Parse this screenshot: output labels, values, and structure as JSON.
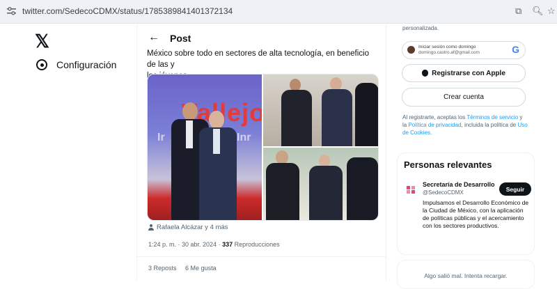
{
  "browser": {
    "url": "twitter.com/SedecoCDMX/status/1785389841401372134",
    "icons": [
      "site-settings-icon",
      "cast-icon",
      "zoom-icon",
      "bookmark-star-icon"
    ]
  },
  "nav": {
    "logo": "𝕏",
    "settings_label": "Configuración"
  },
  "post": {
    "back_arrow": "←",
    "header_title": "Post",
    "text_line1": "México sobre todo en sectores de alta tecnología, en beneficio de las y",
    "text_line2": "los jóvenes",
    "photo_text": "Vallejo",
    "photo_subtext_1": "Ir",
    "photo_subtext_2": "Inr",
    "tagged": "Rafaela Alcázar y 4 más",
    "time": "1:24 p. m. · 30 abr. 2024 · ",
    "views_count": "337",
    "views_label": " Reproducciones",
    "reposts": "3 Reposts",
    "likes": "6 Me gusta"
  },
  "sidebar": {
    "top_text": "personalizada.",
    "google_line1": "Iniciar sesión como domingo",
    "google_line2": "domingo.castro.af@gmail.com",
    "google_logo": "G",
    "apple_label": "Registrarse con Apple",
    "create_label": "Crear cuenta",
    "legal_prefix": "Al registrarte, aceptas los ",
    "legal_terms": "Términos de servicio",
    "legal_and": " y la ",
    "legal_privacy": "Política de privacidad",
    "legal_mid": ", incluida la política de ",
    "legal_cookies": "Uso de Cookies",
    "legal_end": ".",
    "relevant_title": "Personas relevantes",
    "relevant_name": "Secretaría de Desarrollo",
    "relevant_handle": "@SedecoCDMX",
    "follow_label": "Seguir",
    "relevant_bio": "Impulsamos el Desarrollo Económico de la Ciudad de México, con la aplicación de políticas públicas y el acercamiento con los sectores productivos.",
    "error_text": "Algo salió mal. Intenta recargar."
  },
  "colors": {
    "accent": "#1d9bf0",
    "text": "#0f1419",
    "muted": "#536471"
  }
}
